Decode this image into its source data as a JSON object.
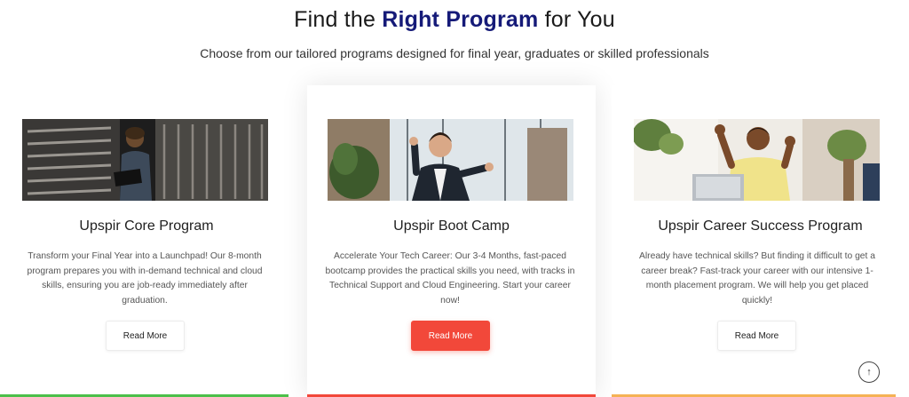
{
  "section": {
    "heading_prefix": "Find the ",
    "heading_accent": "Right Program",
    "heading_suffix": " for You",
    "subtitle": "Choose from our tailored programs designed for final year, graduates or skilled professionals"
  },
  "programs": [
    {
      "title": "Upspir Core Program",
      "description": "Transform your Final Year into a Launchpad! Our 8-month program prepares you with in-demand technical and cloud skills, ensuring you are job-ready immediately after graduation.",
      "button": "Read More",
      "bar_color": "#4cc04a"
    },
    {
      "title": "Upspir Boot Camp",
      "description": "Accelerate Your Tech Career: Our 3-4 Months, fast-paced bootcamp provides the practical skills you need, with tracks in Technical Support and Cloud Engineering. Start your career now!",
      "button": "Read More",
      "bar_color": "#f2483a"
    },
    {
      "title": "Upspir Career Success Program",
      "description": "Already have technical skills? But finding it difficult to get a career break? Fast-track your career with our intensive 1-month placement program. We will help you get placed quickly!",
      "button": "Read More",
      "bar_color": "#f5b255"
    }
  ],
  "scroll_top": {
    "icon": "↑"
  },
  "colors": {
    "accent": "#151a78",
    "primary_button": "#f2483a",
    "decor_blue": "#1aa3e0"
  }
}
